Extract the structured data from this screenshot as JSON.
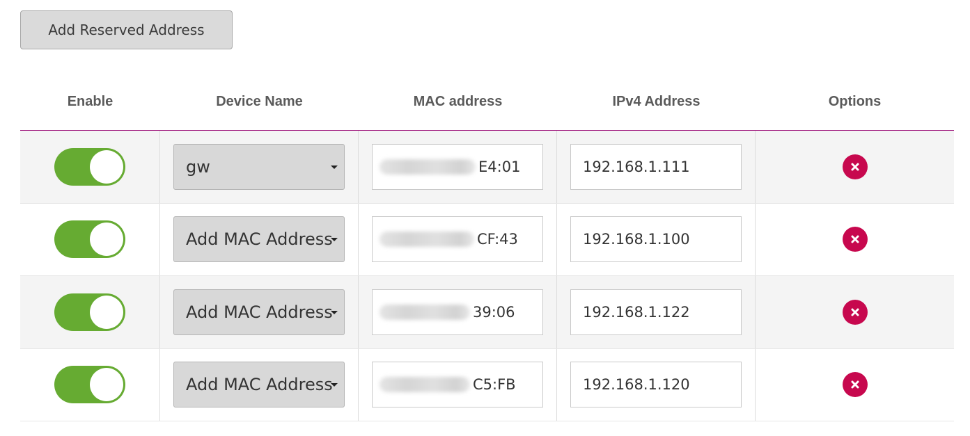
{
  "toolbar": {
    "add_reserved_label": "Add Reserved Address"
  },
  "table": {
    "headers": {
      "enable": "Enable",
      "device_name": "Device Name",
      "mac": "MAC address",
      "ipv4": "IPv4 Address",
      "options": "Options"
    },
    "rows": [
      {
        "enabled": true,
        "device_name": "gw",
        "mac_visible_suffix": "E4:01",
        "ipv4": "192.168.1.111",
        "delete_icon": "close-icon"
      },
      {
        "enabled": true,
        "device_name": "Add MAC Address",
        "mac_visible_suffix": "CF:43",
        "ipv4": "192.168.1.100",
        "delete_icon": "close-icon"
      },
      {
        "enabled": true,
        "device_name": "Add MAC Address",
        "mac_visible_suffix": "39:06",
        "ipv4": "192.168.1.122",
        "delete_icon": "close-icon"
      },
      {
        "enabled": true,
        "device_name": "Add MAC Address",
        "mac_visible_suffix": "C5:FB",
        "ipv4": "192.168.1.120",
        "delete_icon": "close-icon"
      }
    ]
  },
  "colors": {
    "toggle_on": "#66ab32",
    "delete": "#c7084e",
    "header_rule": "#a0197e"
  }
}
